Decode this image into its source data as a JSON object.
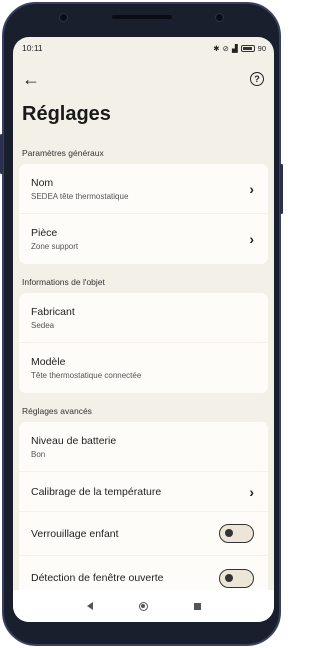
{
  "status": {
    "time": "10:11",
    "battery_text": "90"
  },
  "page": {
    "title": "Réglages"
  },
  "sections": [
    {
      "header": "Paramètres généraux",
      "rows": [
        {
          "title": "Nom",
          "subtitle": "SEDEA tête thermostatique"
        },
        {
          "title": "Pièce",
          "subtitle": "Zone support"
        }
      ]
    },
    {
      "header": "Informations de l'objet",
      "rows": [
        {
          "title": "Fabricant",
          "subtitle": "Sedea"
        },
        {
          "title": "Modèle",
          "subtitle": "Tête thermostatique connectée"
        }
      ]
    },
    {
      "header": "Réglages avancés",
      "rows": [
        {
          "title": "Niveau de batterie",
          "subtitle": "Bon"
        },
        {
          "title": "Calibrage de la température"
        },
        {
          "title": "Verrouillage enfant",
          "toggle": false
        },
        {
          "title": "Détection de fenêtre ouverte",
          "toggle": false
        }
      ]
    }
  ],
  "icons": {
    "back": "arrow-left-icon",
    "help": "question-circle-icon",
    "chevron": "chevron-right-icon"
  }
}
